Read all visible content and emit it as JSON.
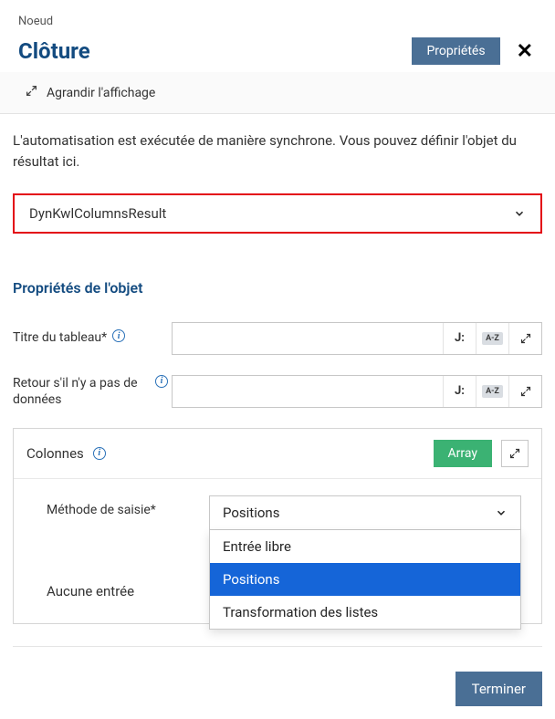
{
  "breadcrumb": "Noeud",
  "page_title": "Clôture",
  "header": {
    "properties_btn": "Propriétés"
  },
  "expand_row": "Agrandir l'affichage",
  "description": "L'automatisation est exécutée de manière synchrone. Vous pouvez définir l'objet du résultat ici.",
  "result_select": {
    "value": "DynKwlColumnsResult"
  },
  "section_title": "Propriétés de l'objet",
  "fields": {
    "table_title_label": "Titre du tableau*",
    "no_data_label": "Retour s'il n'y a pas de données",
    "j_label": "J:",
    "az_label": "A-Z"
  },
  "columns_panel": {
    "title": "Colonnes",
    "array_btn": "Array",
    "method_label": "Méthode de saisie*",
    "method_value": "Positions",
    "options": [
      "Entrée libre",
      "Positions",
      "Transformation des listes"
    ],
    "selected_index": 1,
    "no_entry": "Aucune entrée"
  },
  "footer": {
    "finish_btn": "Terminer"
  }
}
